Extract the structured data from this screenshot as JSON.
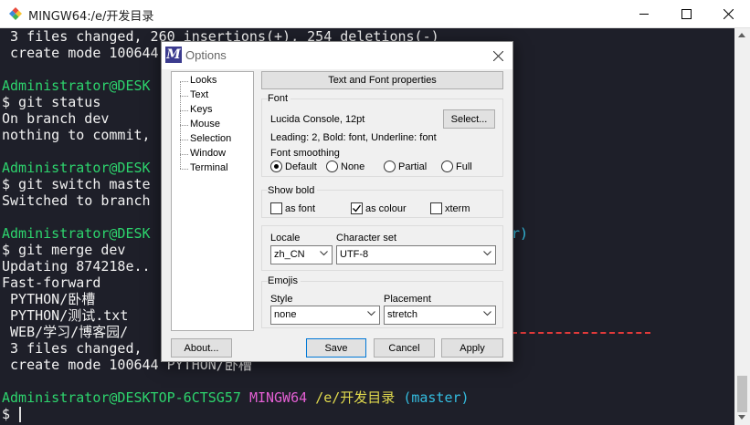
{
  "terminal": {
    "title": "MINGW64:/e/开发目录",
    "lines": [
      {
        "t": " 3 files changed, 260 insertions(+), 254 deletions(-)"
      },
      {
        "t": " create mode 100644 "
      },
      {
        "t": ""
      },
      {
        "prompt_user": "Administrator@DESKTOP-6CTSG57",
        "prompt_sys": "MINGW64",
        "prompt_path": "/e/开发目录",
        "prompt_branch": "(master)",
        "prompt_user_partial": "Administrator@DESK"
      },
      {
        "t": "$ git status"
      },
      {
        "t": "On branch dev"
      },
      {
        "t": "nothing to commit, "
      },
      {
        "t": ""
      },
      {
        "prompt_user_partial": "Administrator@DESK"
      },
      {
        "t": "$ git switch maste"
      },
      {
        "t": "Switched to branch"
      },
      {
        "t": ""
      },
      {
        "prompt_user_partial": "Administrator@DESK",
        "branch_tail": "r)"
      },
      {
        "t": "$ git merge dev"
      },
      {
        "t": "Updating 874218e.."
      },
      {
        "t": "Fast-forward"
      },
      {
        "t": " PYTHON/卧槽"
      },
      {
        "t": " PYTHON/测试.txt"
      },
      {
        "t": " WEB/学习/博客园/"
      },
      {
        "t": " 3 files changed,"
      },
      {
        "t": " create mode 100644 PYTHON/卧槽"
      },
      {
        "t": ""
      }
    ],
    "final_prompt": {
      "user": "Administrator@DESKTOP-6CTSG57",
      "sys": "MINGW64",
      "path": "/e/开发目录",
      "branch": "(master)"
    },
    "input_prompt": "$",
    "colors": {
      "background": "#1e1f29",
      "green": "#2dd46d",
      "magenta": "#e35fd3",
      "yellow": "#e0d94d",
      "cyan": "#34bde0"
    }
  },
  "dialog": {
    "title": "Options",
    "categories": [
      "Looks",
      "Text",
      "Keys",
      "Mouse",
      "Selection",
      "Window",
      "Terminal"
    ],
    "header": "Text and Font properties",
    "font": {
      "group_label": "Font",
      "font_name": "Lucida Console, 12pt",
      "select_label": "Select...",
      "details": "Leading: 2, Bold: font, Underline: font",
      "smoothing_label": "Font smoothing",
      "smoothing_options": [
        "Default",
        "None",
        "Partial",
        "Full"
      ],
      "smoothing_selected": "Default"
    },
    "show_bold": {
      "group_label": "Show bold",
      "options": [
        {
          "label": "as font",
          "checked": false
        },
        {
          "label": "as colour",
          "checked": true
        },
        {
          "label": "xterm",
          "checked": false
        }
      ]
    },
    "locale": {
      "locale_label": "Locale",
      "locale_value": "zh_CN",
      "charset_label": "Character set",
      "charset_value": "UTF-8"
    },
    "emojis": {
      "group_label": "Emojis",
      "style_label": "Style",
      "style_value": "none",
      "placement_label": "Placement",
      "placement_value": "stretch"
    },
    "buttons": {
      "about": "About...",
      "save": "Save",
      "cancel": "Cancel",
      "apply": "Apply"
    }
  }
}
